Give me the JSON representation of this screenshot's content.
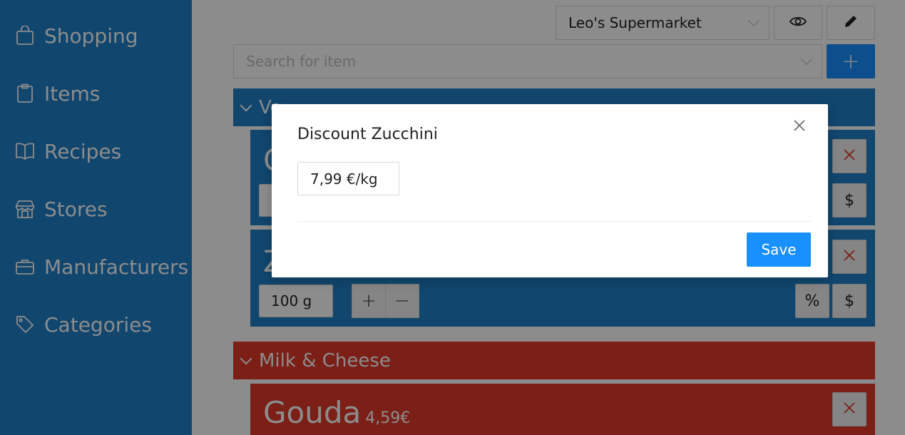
{
  "sidebar": {
    "items": [
      {
        "label": "Shopping",
        "icon": "shopping-bag-icon"
      },
      {
        "label": "Items",
        "icon": "clipboard-icon"
      },
      {
        "label": "Recipes",
        "icon": "book-icon"
      },
      {
        "label": "Stores",
        "icon": "shop-icon"
      },
      {
        "label": "Manufacturers",
        "icon": "briefcase-icon"
      },
      {
        "label": "Categories",
        "icon": "tag-icon"
      }
    ]
  },
  "toolbar": {
    "store_selected": "Leo's Supermarket",
    "search_placeholder": "Search for item",
    "add_label": "+"
  },
  "categories": [
    {
      "name": "Vegetables",
      "visible_fragment": "Ve",
      "color": "#1f80c8",
      "items": [
        {
          "name_fragment": "C",
          "quantity": ""
        },
        {
          "name_fragment": "Z",
          "quantity": "100 g"
        }
      ]
    },
    {
      "name": "Milk & Cheese",
      "color": "#e03a2b",
      "items": [
        {
          "name": "Gouda",
          "price": "4,59€"
        }
      ]
    }
  ],
  "buttons": {
    "plus": "+",
    "minus": "−",
    "percent": "%",
    "dollar": "$"
  },
  "modal": {
    "title": "Discount Zucchini",
    "value": "7,99 €/kg",
    "save_label": "Save"
  },
  "colors": {
    "primary": "#1890ff",
    "sidebar": "#1f80c8",
    "danger": "#e03a2b"
  }
}
